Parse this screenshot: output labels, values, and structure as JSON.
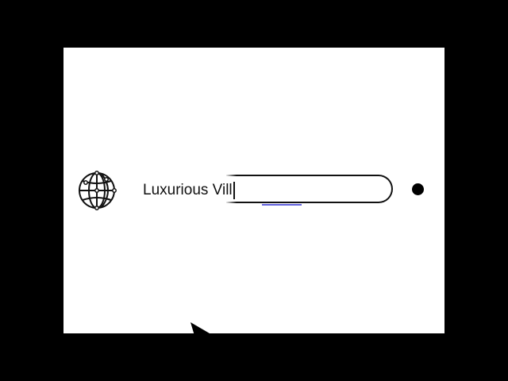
{
  "search": {
    "value": "Luxurious Vill",
    "icon": "globe-icon",
    "action_icon": "dot-icon"
  },
  "colors": {
    "frame": "#000000",
    "background": "#ffffff",
    "ink": "#111111",
    "accent": "#3b3bd6"
  }
}
